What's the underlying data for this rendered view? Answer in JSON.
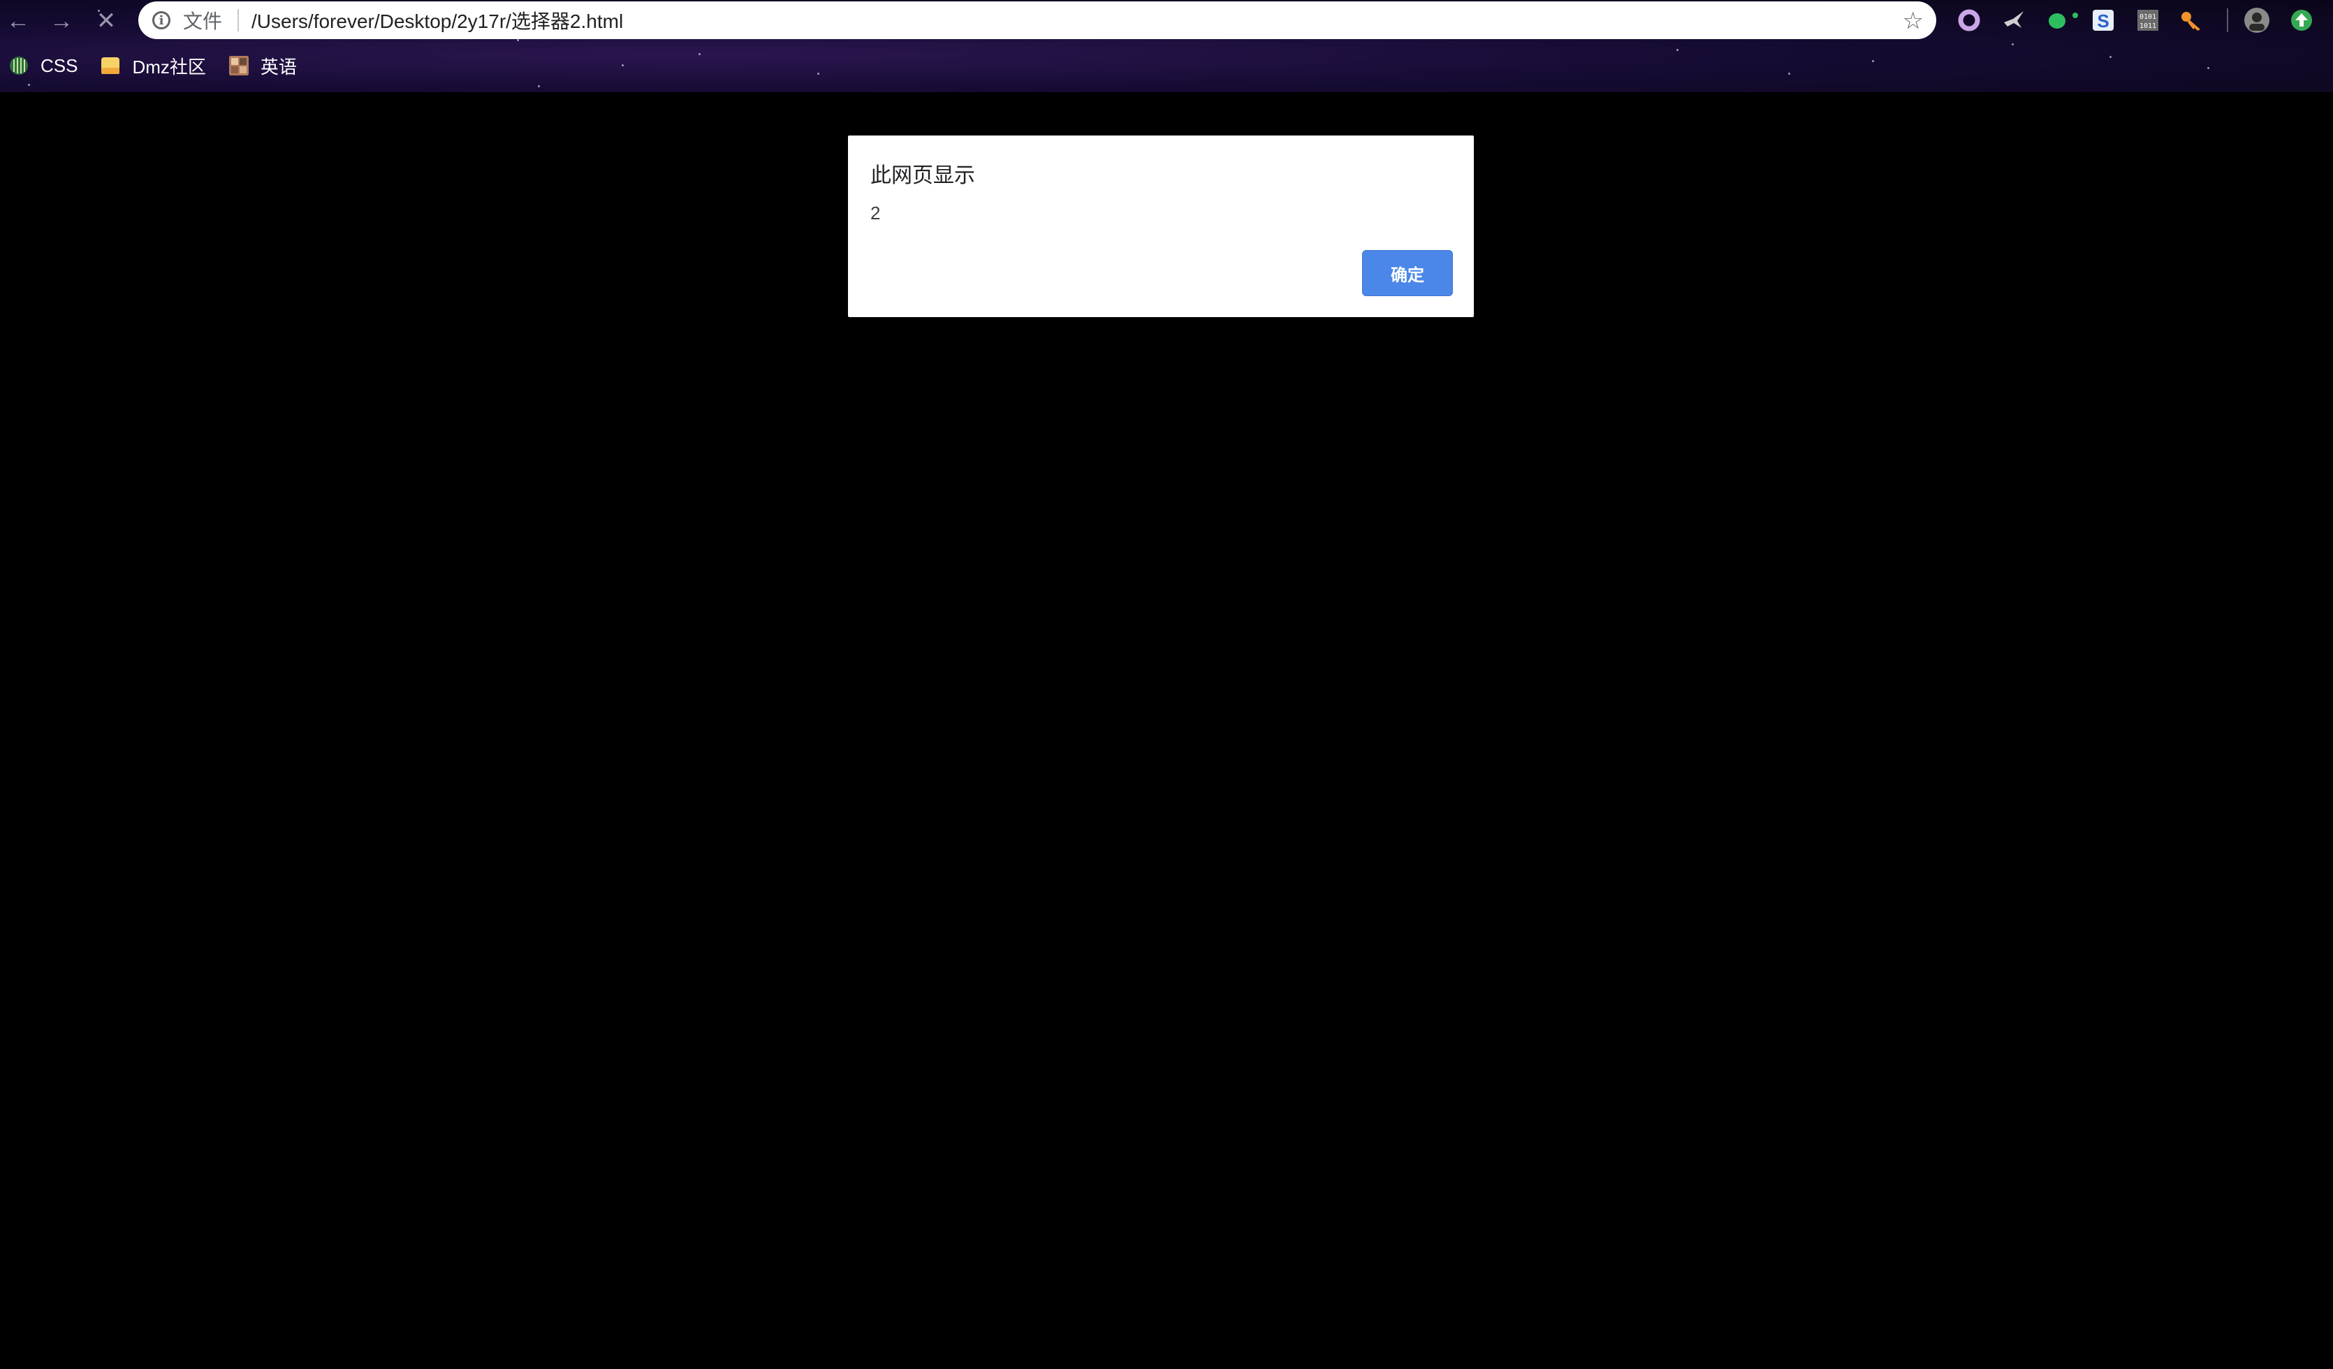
{
  "browser": {
    "nav": {
      "back_icon": "arrow-left-icon",
      "forward_icon": "arrow-right-icon",
      "stop_icon": "close-icon"
    },
    "omnibox": {
      "scheme_label": "文件",
      "url": "/Users/forever/Desktop/2y17r/选择器2.html"
    },
    "extensions": [
      "circle-extension-icon",
      "bird-extension-icon",
      "evernote-elephant-icon",
      "s-extension-icon",
      "binary-extension-icon",
      "key-extension-icon",
      "profile-avatar-icon",
      "update-arrow-icon"
    ]
  },
  "bookmarks": [
    {
      "label": "CSS",
      "icon": "css-globe-icon"
    },
    {
      "label": "Dmz社区",
      "icon": "dmz-folder-icon"
    },
    {
      "label": "英语",
      "icon": "english-image-icon"
    }
  ],
  "dialog": {
    "title": "此网页显示",
    "message": "2",
    "ok_label": "确定"
  },
  "colors": {
    "page_background": "#000000",
    "dialog_button": "#4b87e8",
    "chrome_background": "#160b33"
  }
}
